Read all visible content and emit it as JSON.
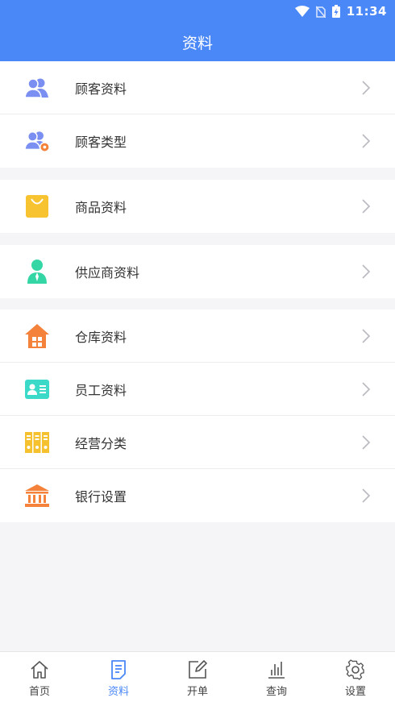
{
  "status": {
    "time": "11:34"
  },
  "header": {
    "title": "资料"
  },
  "groups": [
    {
      "items": [
        {
          "label": "顾客资料",
          "icon": "customers-icon"
        },
        {
          "label": "顾客类型",
          "icon": "customer-type-icon"
        }
      ]
    },
    {
      "items": [
        {
          "label": "商品资料",
          "icon": "shopping-bag-icon"
        }
      ]
    },
    {
      "items": [
        {
          "label": "供应商资料",
          "icon": "supplier-icon"
        }
      ]
    },
    {
      "items": [
        {
          "label": "仓库资料",
          "icon": "warehouse-icon"
        },
        {
          "label": "员工资料",
          "icon": "employee-card-icon"
        },
        {
          "label": "经营分类",
          "icon": "binders-icon"
        },
        {
          "label": "银行设置",
          "icon": "bank-icon"
        }
      ]
    }
  ],
  "tabs": [
    {
      "label": "首页",
      "icon": "home-icon",
      "active": false
    },
    {
      "label": "资料",
      "icon": "document-icon",
      "active": true
    },
    {
      "label": "开单",
      "icon": "edit-icon",
      "active": false
    },
    {
      "label": "查询",
      "icon": "bar-chart-icon",
      "active": false
    },
    {
      "label": "设置",
      "icon": "gear-icon",
      "active": false
    }
  ],
  "colors": {
    "primary": "#4a87f7",
    "customer_icon": "#7b8ff2",
    "bag_icon": "#f7c331",
    "supplier_icon": "#35d6a5",
    "warehouse_icon": "#f4823a",
    "employee_icon": "#3bd9c7",
    "binders_icon": "#f5c12e",
    "bank_icon": "#f4823a"
  }
}
